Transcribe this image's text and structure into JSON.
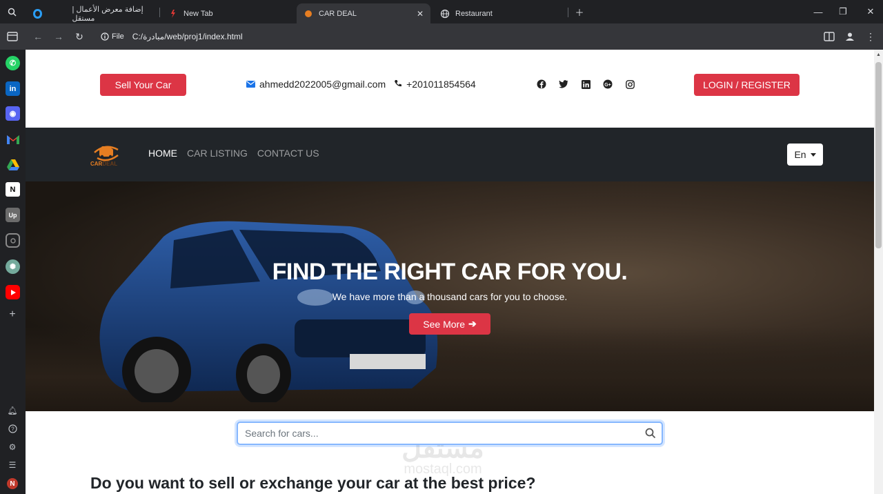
{
  "browser": {
    "tabs": [
      {
        "title": "إضافة معرض الأعمال | مستقل"
      },
      {
        "title": "New Tab"
      },
      {
        "title": "CAR DEAL",
        "active": true
      },
      {
        "title": "Restaurant"
      }
    ],
    "address": {
      "chip": "File",
      "url": "C:/مبادرة/web/proj1/index.html"
    }
  },
  "sidebar": {
    "apps": [
      "whatsapp-icon",
      "linkedin-icon",
      "discord-icon",
      "gmail-icon",
      "google-drive-icon",
      "notion-icon",
      "upwork-icon",
      "instagram-icon",
      "chatgpt-icon",
      "youtube-icon"
    ]
  },
  "topbar": {
    "sell_label": "Sell Your Car",
    "email": "ahmedd2022005@gmail.com",
    "phone": "+201011854564",
    "login_label": "LOGIN / REGISTER"
  },
  "navbar": {
    "logo_text_1": "CAR",
    "logo_text_2": "DEAL",
    "links": [
      {
        "label": "HOME",
        "active": true
      },
      {
        "label": "CAR LISTING"
      },
      {
        "label": "CONTACT US"
      }
    ],
    "language": "En"
  },
  "hero": {
    "title": "FIND THE RIGHT CAR FOR YOU.",
    "subtitle": "We have more than a thousand cars for you to choose.",
    "cta_label": "See More"
  },
  "search": {
    "placeholder": "Search for cars..."
  },
  "watermark": {
    "arabic": "مستقل",
    "latin": "mostaql.com"
  },
  "section": {
    "title": "Do you want to sell or exchange your car at the best price?"
  },
  "colors": {
    "accent": "#dc3545",
    "navbar": "#212529",
    "contact_icon": "#1a73e8"
  }
}
